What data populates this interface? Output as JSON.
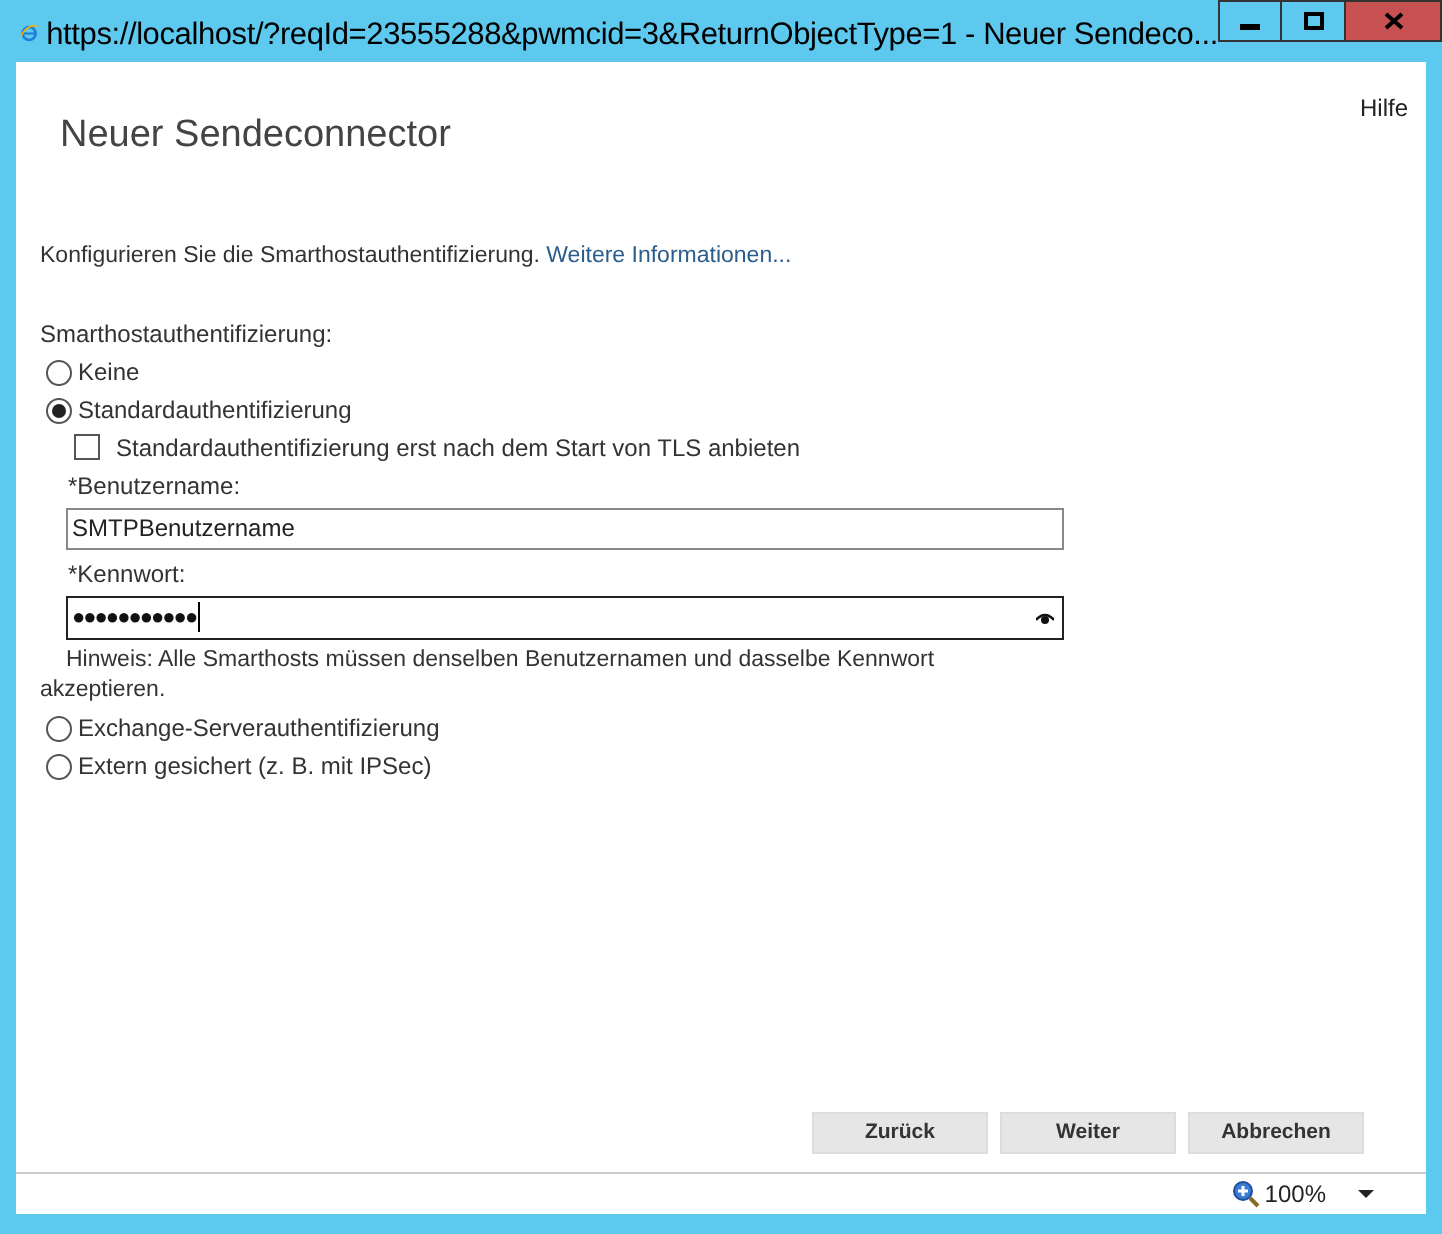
{
  "window": {
    "title": "https://localhost/?reqId=23555288&pwmcid=3&ReturnObjectType=1 - Neuer Sendeco..."
  },
  "help_link": "Hilfe",
  "heading": "Neuer Sendeconnector",
  "intro": {
    "text": "Konfigurieren Sie die Smarthostauthentifizierung.",
    "link": "Weitere Informationen..."
  },
  "auth_label": "Smarthostauthentifizierung:",
  "options_top": [
    {
      "label": "Keine",
      "selected": false
    },
    {
      "label": "Standardauthentifizierung",
      "selected": true
    }
  ],
  "tls_checkbox": {
    "label": "Standardauthentifizierung erst nach dem Start von TLS anbieten",
    "checked": false
  },
  "username": {
    "label": "*Benutzername:",
    "value": "SMTPBenutzername"
  },
  "password": {
    "label": "*Kennwort:",
    "value": "●●●●●●●●●●●",
    "focused": true
  },
  "hint": "Hinweis: Alle Smarthosts müssen denselben Benutzernamen und dasselbe Kennwort akzeptieren.",
  "options_bottom": [
    {
      "label": "Exchange-Serverauthentifizierung",
      "selected": false
    },
    {
      "label": "Extern gesichert (z. B. mit IPSec)",
      "selected": false
    }
  ],
  "buttons": [
    "Zurück",
    "Weiter",
    "Abbrechen"
  ],
  "status_bar": {
    "zoom": "100%"
  }
}
